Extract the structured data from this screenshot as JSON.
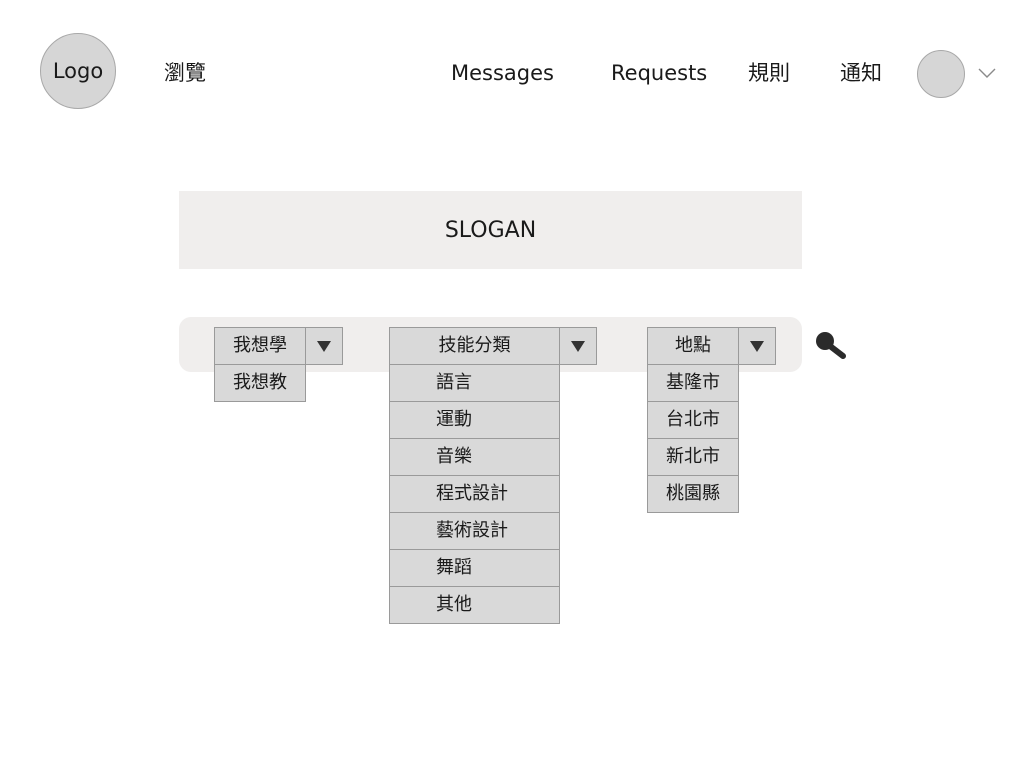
{
  "header": {
    "logo": "Logo",
    "browse": "瀏覽",
    "nav": [
      "Messages",
      "Requests",
      "規則",
      "通知"
    ],
    "avatar_caret_icon": "chevron-down-icon"
  },
  "slogan": "SLOGAN",
  "search": {
    "mode": {
      "selected": "我想學",
      "options": [
        "我想教"
      ]
    },
    "category": {
      "selected": "技能分類",
      "options": [
        "語言",
        "運動",
        "音樂",
        "程式設計",
        "藝術設計",
        "舞蹈",
        "其他"
      ]
    },
    "location": {
      "selected": "地點",
      "options": [
        "基隆市",
        "台北市",
        "新北市",
        "桃園縣"
      ]
    },
    "search_icon": "search-icon",
    "dropdown_icon": "triangle-down-icon"
  },
  "colors": {
    "panel_bg": "#f0eeed",
    "control_bg": "#d9d9d9",
    "control_border": "#9a9a9a",
    "avatar_bg": "#d6d6d6"
  }
}
